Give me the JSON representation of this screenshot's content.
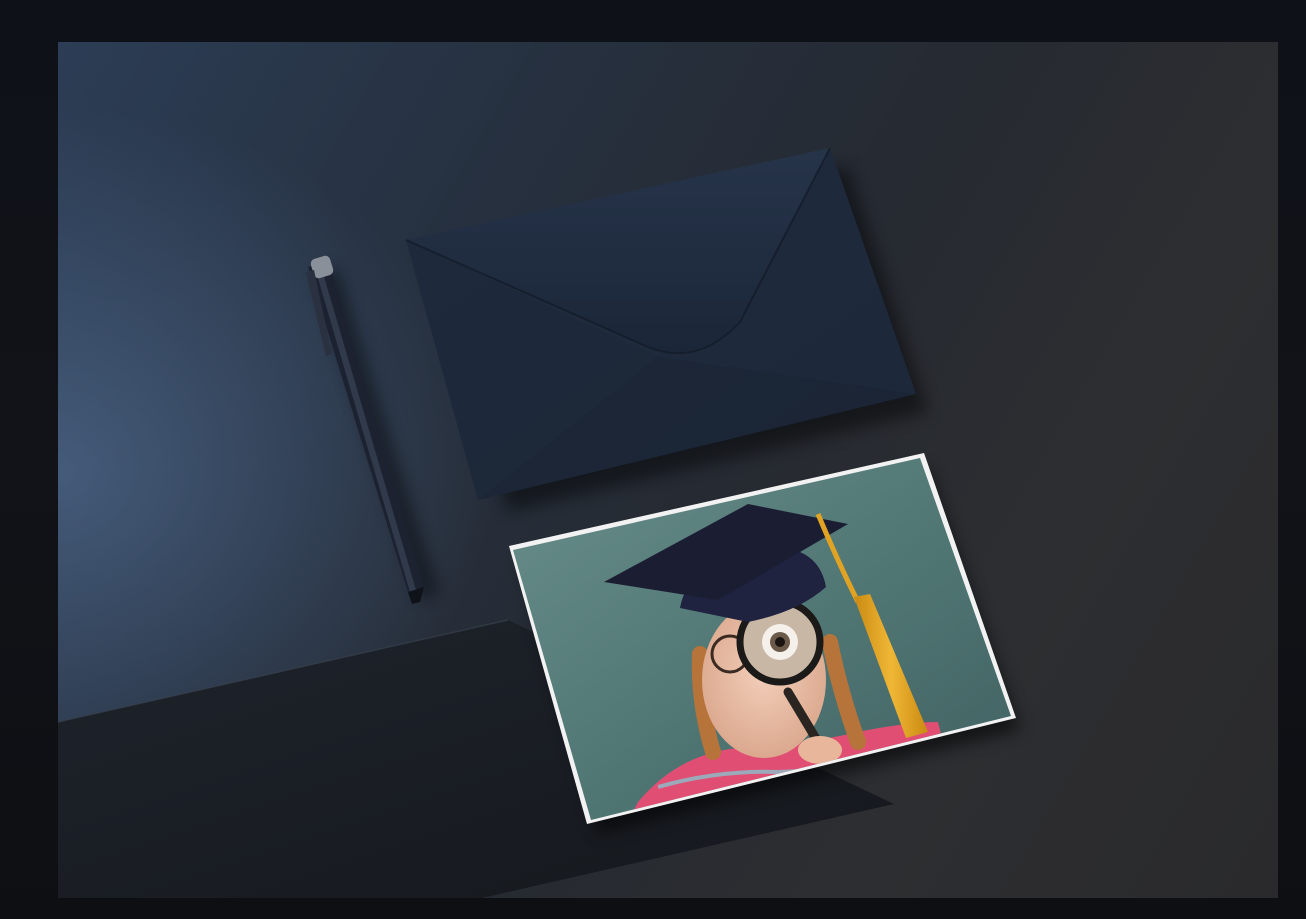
{
  "image": {
    "subject": "",
    "colors": {
      "outer_frame": "#0b0d11",
      "desk_blue": "#2c3d55",
      "desk_dark": "#2a2a2c",
      "envelope": "#1f2a3a",
      "photo_wall": "#4e7474",
      "cap": "#1b1e33",
      "tassel": "#e0a323",
      "shirt": "#e04f73"
    }
  }
}
